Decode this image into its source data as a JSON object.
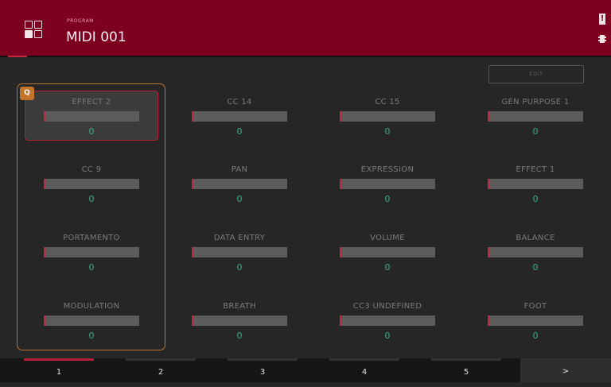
{
  "header": {
    "program_label": "PROGRAM",
    "program_name": "MIDI 001",
    "warning_glyph": "!"
  },
  "edit_label": "EDIT",
  "q_link_label": "Q",
  "knobs": [
    {
      "name": "EFFECT 2",
      "value": "0"
    },
    {
      "name": "CC 14",
      "value": "0"
    },
    {
      "name": "CC 15",
      "value": "0"
    },
    {
      "name": "GEN PURPOSE 1",
      "value": "0"
    },
    {
      "name": "CC 9",
      "value": "0"
    },
    {
      "name": "PAN",
      "value": "0"
    },
    {
      "name": "EXPRESSION",
      "value": "0"
    },
    {
      "name": "EFFECT 1",
      "value": "0"
    },
    {
      "name": "PORTAMENTO",
      "value": "0"
    },
    {
      "name": "DATA ENTRY",
      "value": "0"
    },
    {
      "name": "VOLUME",
      "value": "0"
    },
    {
      "name": "BALANCE",
      "value": "0"
    },
    {
      "name": "MODULATION",
      "value": "0"
    },
    {
      "name": "BREATH",
      "value": "0"
    },
    {
      "name": "CC3 UNDEFINED",
      "value": "0"
    },
    {
      "name": "FOOT",
      "value": "0"
    }
  ],
  "tabs": [
    "1",
    "2",
    "3",
    "4",
    "5"
  ],
  "next_label": ">",
  "active_tab": 0,
  "colors": {
    "header": "#7e0020",
    "accent": "#b51f36",
    "value_text": "#3fae8b",
    "q_link": "#c4752a"
  }
}
